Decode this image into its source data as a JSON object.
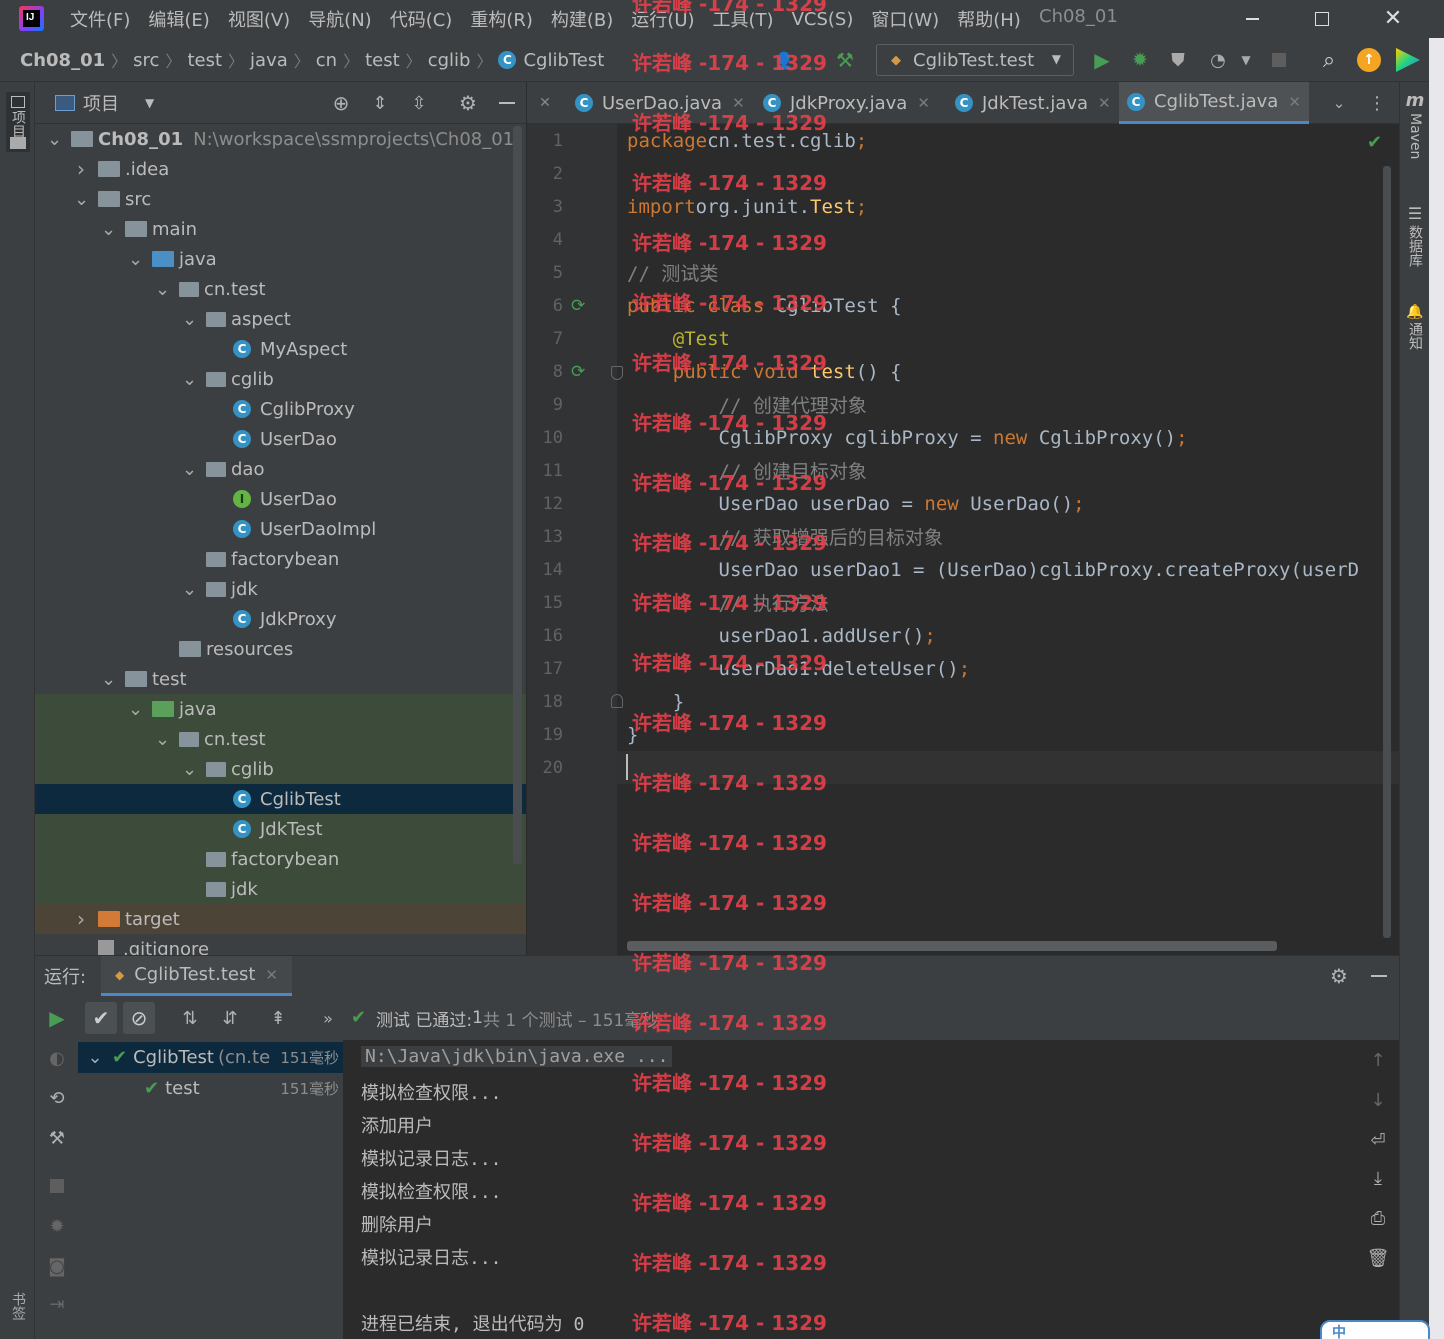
{
  "titlebar": {
    "menu": [
      "文件(F)",
      "编辑(E)",
      "视图(V)",
      "导航(N)",
      "代码(C)",
      "重构(R)",
      "构建(B)",
      "运行(U)",
      "工具(T)",
      "VCS(S)",
      "窗口(W)",
      "帮助(H)"
    ],
    "project_name": "Ch08_01"
  },
  "breadcrumbs": [
    "Ch08_01",
    "src",
    "test",
    "java",
    "cn",
    "test",
    "cglib",
    "CglibTest"
  ],
  "run_config": "CglibTest.test",
  "project_panel": {
    "title": "项目",
    "tree": [
      {
        "label": "Ch08_01",
        "extra": "N:\\workspace\\ssmprojects\\Ch08_01",
        "depth": 0,
        "arrow": "open",
        "icon": "module-folder"
      },
      {
        "label": ".idea",
        "depth": 1,
        "arrow": "closed",
        "icon": "folder"
      },
      {
        "label": "src",
        "depth": 1,
        "arrow": "open",
        "icon": "folder"
      },
      {
        "label": "main",
        "depth": 2,
        "arrow": "open",
        "icon": "folder"
      },
      {
        "label": "java",
        "depth": 3,
        "arrow": "open",
        "icon": "folder-blue"
      },
      {
        "label": "cn.test",
        "depth": 4,
        "arrow": "open",
        "icon": "package"
      },
      {
        "label": "aspect",
        "depth": 5,
        "arrow": "open",
        "icon": "package"
      },
      {
        "label": "MyAspect",
        "depth": 6,
        "icon": "class"
      },
      {
        "label": "cglib",
        "depth": 5,
        "arrow": "open",
        "icon": "package"
      },
      {
        "label": "CglibProxy",
        "depth": 6,
        "icon": "class"
      },
      {
        "label": "UserDao",
        "depth": 6,
        "icon": "class"
      },
      {
        "label": "dao",
        "depth": 5,
        "arrow": "open",
        "icon": "package"
      },
      {
        "label": "UserDao",
        "depth": 6,
        "icon": "interface"
      },
      {
        "label": "UserDaoImpl",
        "depth": 6,
        "icon": "class"
      },
      {
        "label": "factorybean",
        "depth": 5,
        "icon": "package"
      },
      {
        "label": "jdk",
        "depth": 5,
        "arrow": "open",
        "icon": "package"
      },
      {
        "label": "JdkProxy",
        "depth": 6,
        "icon": "class"
      },
      {
        "label": "resources",
        "depth": 4,
        "icon": "resources"
      },
      {
        "label": "test",
        "depth": 2,
        "arrow": "open",
        "icon": "folder"
      },
      {
        "label": "java",
        "depth": 3,
        "arrow": "open",
        "icon": "folder-green",
        "bg": "test"
      },
      {
        "label": "cn.test",
        "depth": 4,
        "arrow": "open",
        "icon": "package",
        "bg": "test"
      },
      {
        "label": "cglib",
        "depth": 5,
        "arrow": "open",
        "icon": "package",
        "bg": "test"
      },
      {
        "label": "CglibTest",
        "depth": 6,
        "icon": "test-class",
        "bg": "selected"
      },
      {
        "label": "JdkTest",
        "depth": 6,
        "icon": "test-class",
        "bg": "test"
      },
      {
        "label": "factorybean",
        "depth": 5,
        "icon": "package",
        "bg": "test"
      },
      {
        "label": "jdk",
        "depth": 5,
        "icon": "package",
        "bg": "test"
      },
      {
        "label": "target",
        "depth": 1,
        "arrow": "closed",
        "icon": "folder-orange",
        "bg": "excluded"
      },
      {
        "label": ".gitignore",
        "depth": 1,
        "icon": "file"
      }
    ]
  },
  "editor_tabs": [
    {
      "label": "UserDao.java",
      "active": false
    },
    {
      "label": "JdkProxy.java",
      "active": false
    },
    {
      "label": "JdkTest.java",
      "active": false
    },
    {
      "label": "CglibTest.java",
      "active": true
    }
  ],
  "code_lines": [
    [
      [
        "kw",
        "package"
      ],
      [
        "",
        "cn.test.cglib"
      ],
      [
        "kw",
        ";"
      ]
    ],
    [],
    [
      [
        "kw",
        "import"
      ],
      [
        "",
        "org.junit."
      ],
      [
        "fn",
        "Test"
      ],
      [
        "kw",
        ";"
      ]
    ],
    [],
    [
      [
        "cm",
        "// 测试类"
      ]
    ],
    [
      [
        "kw",
        "public class "
      ],
      [
        "",
        "CglibTest {"
      ]
    ],
    [
      [
        "ann",
        "    @Test"
      ]
    ],
    [
      [
        "kw",
        "    public void "
      ],
      [
        "fn",
        "test"
      ],
      [
        "",
        "() {"
      ]
    ],
    [
      [
        "cm",
        "        // 创建代理对象"
      ]
    ],
    [
      [
        "",
        "        CglibProxy cglibProxy = "
      ],
      [
        "kw",
        "new "
      ],
      [
        "",
        "CglibProxy()"
      ],
      [
        "kw",
        ";"
      ]
    ],
    [
      [
        "cm",
        "        // 创建目标对象"
      ]
    ],
    [
      [
        "",
        "        UserDao userDao = "
      ],
      [
        "kw",
        "new "
      ],
      [
        "",
        "UserDao()"
      ],
      [
        "kw",
        ";"
      ]
    ],
    [
      [
        "cm",
        "        // 获取增强后的目标对象"
      ]
    ],
    [
      [
        "",
        "        UserDao userDao1 = (UserDao)cglibProxy.createProxy(userD"
      ]
    ],
    [
      [
        "cm",
        "        // 执行方法"
      ]
    ],
    [
      [
        "",
        "        userDao1.addUser()"
      ],
      [
        "kw",
        ";"
      ]
    ],
    [
      [
        "",
        "        userDao1.deleteUser()"
      ],
      [
        "kw",
        ";"
      ]
    ],
    [
      [
        "",
        "    }"
      ]
    ],
    [
      [
        "",
        "}"
      ]
    ],
    []
  ],
  "run_panel": {
    "label": "运行:",
    "config_tab": "CglibTest.test",
    "status_prefix": "测试 已通过:",
    "status_count": "1",
    "status_detail": "共 1 个测试 – 151毫秒",
    "tests": [
      {
        "name": "CglibTest",
        "detail": "(cn.te",
        "time": "151毫秒"
      },
      {
        "name": "test",
        "time": "151毫秒"
      }
    ],
    "output": [
      "N:\\Java\\jdk\\bin\\java.exe ...",
      "模拟检查权限...",
      "添加用户",
      "模拟记录日志...",
      "模拟检查权限...",
      "删除用户",
      "模拟记录日志...",
      "",
      "进程已结束, 退出代码为 0"
    ]
  },
  "right_strip": {
    "maven_glyph": "m",
    "maven": "Maven",
    "database": "数据库",
    "notifications": "通知"
  },
  "left_strip": {
    "project": "项目",
    "bookmarks": "书签"
  },
  "watermark": {
    "text": "许若峰 -174 - 1329",
    "rows": [
      3,
      62,
      122,
      182,
      242,
      302,
      362,
      422,
      482,
      542,
      602,
      662,
      722,
      782,
      842,
      902,
      962,
      1022,
      1082,
      1142,
      1202,
      1262,
      1322
    ]
  },
  "ime_indicator": "中",
  "colors": {
    "accent": "#4a88c7",
    "success": "#499c54",
    "watermark": "#e8404a",
    "selected": "#0d293e",
    "test_bg": "#3d4b3a"
  }
}
